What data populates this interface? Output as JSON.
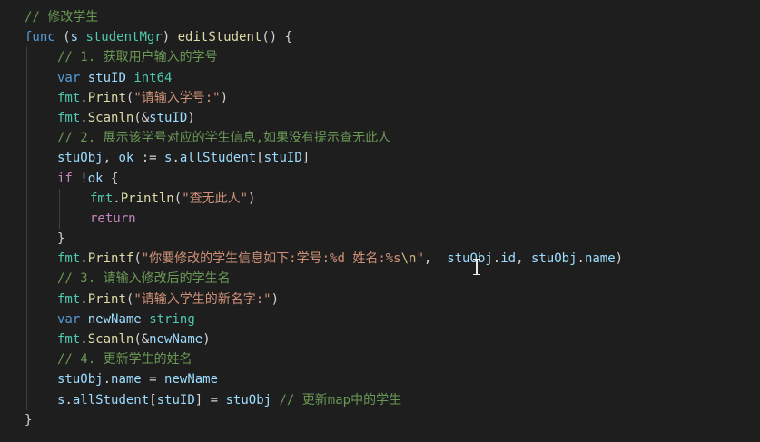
{
  "editor": {
    "lines": [
      {
        "indent": 0,
        "tokens": [
          {
            "t": "// 修改学生",
            "c": "comment"
          }
        ]
      },
      {
        "indent": 0,
        "tokens": [
          {
            "t": "func",
            "c": "kw"
          },
          {
            "t": " (",
            "c": "plain"
          },
          {
            "t": "s",
            "c": "var"
          },
          {
            "t": " ",
            "c": "plain"
          },
          {
            "t": "studentMgr",
            "c": "type"
          },
          {
            "t": ") ",
            "c": "plain"
          },
          {
            "t": "editStudent",
            "c": "fn"
          },
          {
            "t": "() {",
            "c": "plain"
          }
        ]
      },
      {
        "indent": 1,
        "tokens": [
          {
            "t": "// 1. 获取用户输入的学号",
            "c": "comment"
          }
        ]
      },
      {
        "indent": 1,
        "tokens": [
          {
            "t": "var",
            "c": "kw"
          },
          {
            "t": " ",
            "c": "plain"
          },
          {
            "t": "stuID",
            "c": "var"
          },
          {
            "t": " ",
            "c": "plain"
          },
          {
            "t": "int64",
            "c": "type"
          }
        ]
      },
      {
        "indent": 1,
        "tokens": [
          {
            "t": "fmt",
            "c": "type"
          },
          {
            "t": ".",
            "c": "plain"
          },
          {
            "t": "Print",
            "c": "fn"
          },
          {
            "t": "(",
            "c": "plain"
          },
          {
            "t": "\"请输入学号:\"",
            "c": "str"
          },
          {
            "t": ")",
            "c": "plain"
          }
        ]
      },
      {
        "indent": 1,
        "tokens": [
          {
            "t": "fmt",
            "c": "type"
          },
          {
            "t": ".",
            "c": "plain"
          },
          {
            "t": "Scanln",
            "c": "fn"
          },
          {
            "t": "(&",
            "c": "plain"
          },
          {
            "t": "stuID",
            "c": "var"
          },
          {
            "t": ")",
            "c": "plain"
          }
        ]
      },
      {
        "indent": 1,
        "tokens": [
          {
            "t": "// 2. 展示该学号对应的学生信息,如果没有提示查无此人",
            "c": "comment"
          }
        ]
      },
      {
        "indent": 1,
        "tokens": [
          {
            "t": "stuObj",
            "c": "var"
          },
          {
            "t": ", ",
            "c": "plain"
          },
          {
            "t": "ok",
            "c": "var"
          },
          {
            "t": " := ",
            "c": "plain"
          },
          {
            "t": "s",
            "c": "var"
          },
          {
            "t": ".",
            "c": "plain"
          },
          {
            "t": "allStudent",
            "c": "var"
          },
          {
            "t": "[",
            "c": "plain"
          },
          {
            "t": "stuID",
            "c": "var"
          },
          {
            "t": "]",
            "c": "plain"
          }
        ]
      },
      {
        "indent": 1,
        "tokens": [
          {
            "t": "if",
            "c": "ctrl"
          },
          {
            "t": " !",
            "c": "plain"
          },
          {
            "t": "ok",
            "c": "var"
          },
          {
            "t": " {",
            "c": "plain"
          }
        ]
      },
      {
        "indent": 2,
        "tokens": [
          {
            "t": "fmt",
            "c": "type"
          },
          {
            "t": ".",
            "c": "plain"
          },
          {
            "t": "Println",
            "c": "fn"
          },
          {
            "t": "(",
            "c": "plain"
          },
          {
            "t": "\"查无此人\"",
            "c": "str"
          },
          {
            "t": ")",
            "c": "plain"
          }
        ]
      },
      {
        "indent": 2,
        "tokens": [
          {
            "t": "return",
            "c": "ctrl"
          }
        ]
      },
      {
        "indent": 1,
        "tokens": [
          {
            "t": "}",
            "c": "plain"
          }
        ]
      },
      {
        "indent": 1,
        "tokens": [
          {
            "t": "fmt",
            "c": "type"
          },
          {
            "t": ".",
            "c": "plain"
          },
          {
            "t": "Printf",
            "c": "fn"
          },
          {
            "t": "(",
            "c": "plain"
          },
          {
            "t": "\"你要修改的学生信息如下:学号:%d 姓名:%s",
            "c": "str"
          },
          {
            "t": "\\n",
            "c": "esc"
          },
          {
            "t": "\"",
            "c": "str"
          },
          {
            "t": ",  ",
            "c": "plain"
          },
          {
            "t": "stuObj",
            "c": "var"
          },
          {
            "t": ".",
            "c": "plain"
          },
          {
            "t": "id",
            "c": "var"
          },
          {
            "t": ", ",
            "c": "plain"
          },
          {
            "t": "stuObj",
            "c": "var"
          },
          {
            "t": ".",
            "c": "plain"
          },
          {
            "t": "name",
            "c": "var"
          },
          {
            "t": ")",
            "c": "plain"
          }
        ]
      },
      {
        "indent": 1,
        "tokens": [
          {
            "t": "// 3. 请输入修改后的学生名",
            "c": "comment"
          }
        ]
      },
      {
        "indent": 1,
        "tokens": [
          {
            "t": "fmt",
            "c": "type"
          },
          {
            "t": ".",
            "c": "plain"
          },
          {
            "t": "Print",
            "c": "fn"
          },
          {
            "t": "(",
            "c": "plain"
          },
          {
            "t": "\"请输入学生的新名字:\"",
            "c": "str"
          },
          {
            "t": ")",
            "c": "plain"
          }
        ]
      },
      {
        "indent": 1,
        "tokens": [
          {
            "t": "var",
            "c": "kw"
          },
          {
            "t": " ",
            "c": "plain"
          },
          {
            "t": "newName",
            "c": "var"
          },
          {
            "t": " ",
            "c": "plain"
          },
          {
            "t": "string",
            "c": "type"
          }
        ]
      },
      {
        "indent": 1,
        "tokens": [
          {
            "t": "fmt",
            "c": "type"
          },
          {
            "t": ".",
            "c": "plain"
          },
          {
            "t": "Scanln",
            "c": "fn"
          },
          {
            "t": "(&",
            "c": "plain"
          },
          {
            "t": "newName",
            "c": "var"
          },
          {
            "t": ")",
            "c": "plain"
          }
        ]
      },
      {
        "indent": 1,
        "tokens": [
          {
            "t": "// 4. 更新学生的姓名",
            "c": "comment"
          }
        ]
      },
      {
        "indent": 1,
        "tokens": [
          {
            "t": "stuObj",
            "c": "var"
          },
          {
            "t": ".",
            "c": "plain"
          },
          {
            "t": "name",
            "c": "var"
          },
          {
            "t": " = ",
            "c": "plain"
          },
          {
            "t": "newName",
            "c": "var"
          }
        ]
      },
      {
        "indent": 1,
        "tokens": [
          {
            "t": "s",
            "c": "var"
          },
          {
            "t": ".",
            "c": "plain"
          },
          {
            "t": "allStudent",
            "c": "var"
          },
          {
            "t": "[",
            "c": "plain"
          },
          {
            "t": "stuID",
            "c": "var"
          },
          {
            "t": "] = ",
            "c": "plain"
          },
          {
            "t": "stuObj",
            "c": "var"
          },
          {
            "t": " // 更新map中的学生",
            "c": "comment"
          }
        ]
      },
      {
        "indent": 0,
        "tokens": [
          {
            "t": "}",
            "c": "plain"
          }
        ]
      }
    ]
  },
  "colors": {
    "background": "#1e1e1e",
    "keyword": "#569cd6",
    "function": "#dcdcaa",
    "variable": "#9cdcfe",
    "type": "#4ec9b0",
    "string": "#ce9178",
    "comment": "#6a9955",
    "control": "#c586c0"
  }
}
